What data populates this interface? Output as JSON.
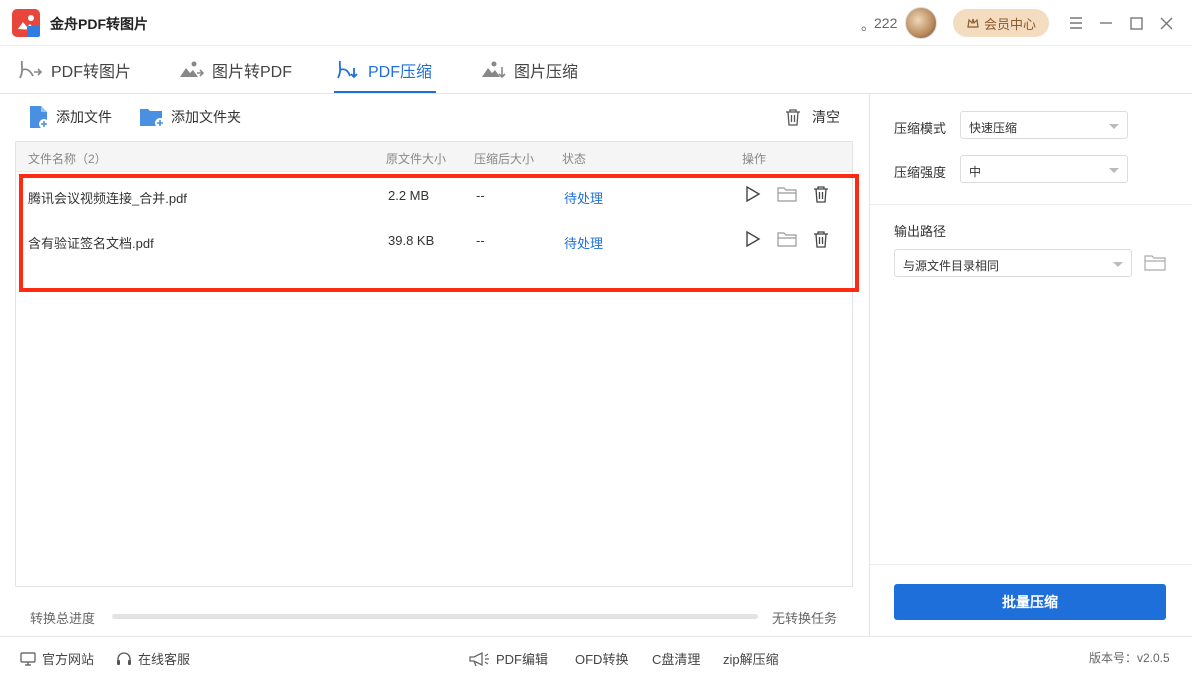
{
  "app": {
    "title": "金舟PDF转图片",
    "user_prefix": "。",
    "user_count": "222",
    "member_label": "会员中心"
  },
  "tabs": [
    {
      "label": "PDF转图片",
      "icon": "pdf-to-image-icon",
      "active": false
    },
    {
      "label": "图片转PDF",
      "icon": "image-to-pdf-icon",
      "active": false
    },
    {
      "label": "PDF压缩",
      "icon": "pdf-compress-icon",
      "active": true
    },
    {
      "label": "图片压缩",
      "icon": "image-compress-icon",
      "active": false
    }
  ],
  "toolbar": {
    "add_file": "添加文件",
    "add_folder": "添加文件夹",
    "clear": "清空"
  },
  "table": {
    "headers": {
      "name": "文件名称（2）",
      "original_size": "原文件大小",
      "compressed_size": "压缩后大小",
      "status": "状态",
      "actions": "操作"
    },
    "rows": [
      {
        "name": "腾讯会议视频连接_合并.pdf",
        "original_size": "2.2 MB",
        "compressed_size": "--",
        "status": "待处理"
      },
      {
        "name": "含有验证签名文档.pdf",
        "original_size": "39.8 KB",
        "compressed_size": "--",
        "status": "待处理"
      }
    ]
  },
  "progress": {
    "label": "转换总进度",
    "value": 0,
    "status": "无转换任务"
  },
  "options": {
    "mode_label": "压缩模式",
    "mode_value": "快速压缩",
    "strength_label": "压缩强度",
    "strength_value": "中",
    "output_label": "输出路径",
    "output_value": "与源文件目录相同",
    "submit": "批量压缩"
  },
  "footer": {
    "website": "官方网站",
    "support": "在线客服",
    "links": [
      "PDF编辑",
      "OFD转换",
      "C盘清理",
      "zip解压缩"
    ],
    "version": "版本号：v2.0.5"
  },
  "colors": {
    "accent": "#1e6fd9",
    "highlight": "#ff2a12",
    "member_bg": "#f3dcc0"
  }
}
